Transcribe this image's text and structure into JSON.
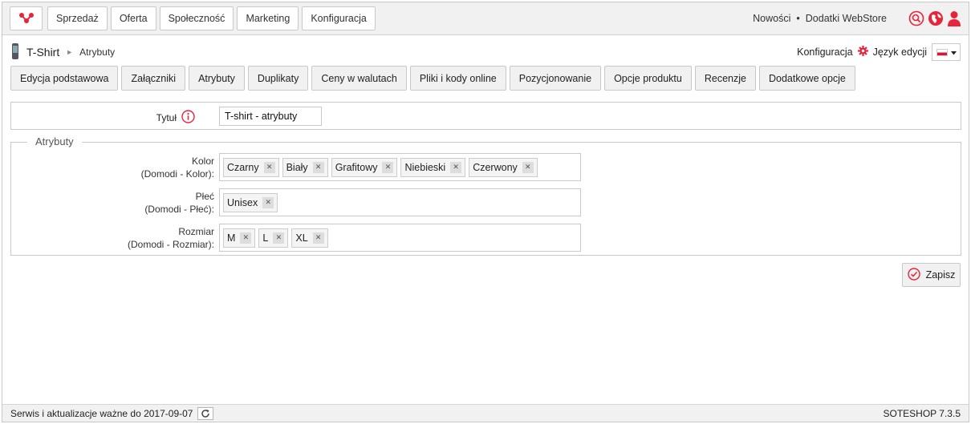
{
  "topbar": {
    "logo_icon": "soteshop-logo-icon",
    "nav": [
      {
        "label": "Sprzedaż"
      },
      {
        "label": "Oferta"
      },
      {
        "label": "Społeczność"
      },
      {
        "label": "Marketing"
      },
      {
        "label": "Konfiguracja"
      }
    ],
    "news_label": "Nowości",
    "separator": "•",
    "addons_label": "Dodatki WebStore",
    "icons": [
      "search-icon",
      "globe-icon",
      "user-icon"
    ],
    "accent_color": "#e8233a"
  },
  "breadcrumb": {
    "product": "T-Shirt",
    "arrow": "►",
    "current": "Atrybuty",
    "config_label": "Konfiguracja",
    "lang_label": "Język edycji"
  },
  "tabs": [
    {
      "label": "Edycja podstawowa"
    },
    {
      "label": "Załączniki"
    },
    {
      "label": "Atrybuty"
    },
    {
      "label": "Duplikaty"
    },
    {
      "label": "Ceny w walutach"
    },
    {
      "label": "Pliki i kody online"
    },
    {
      "label": "Pozycjonowanie"
    },
    {
      "label": "Opcje produktu"
    },
    {
      "label": "Recenzje"
    },
    {
      "label": "Dodatkowe opcje"
    }
  ],
  "title_field": {
    "label": "Tytuł",
    "value": "T-shirt - atrybuty"
  },
  "attributes": {
    "legend": "Atrybuty",
    "rows": [
      {
        "name": "Kolor",
        "sub": "(Domodi - Kolor):",
        "tags": [
          "Czarny",
          "Biały",
          "Grafitowy",
          "Niebieski",
          "Czerwony"
        ]
      },
      {
        "name": "Płeć",
        "sub": "(Domodi - Płeć):",
        "tags": [
          "Unisex"
        ]
      },
      {
        "name": "Rozmiar",
        "sub": "(Domodi - Rozmiar):",
        "tags": [
          "M",
          "L",
          "XL"
        ]
      }
    ]
  },
  "save_label": "Zapisz",
  "footer": {
    "service_text": "Serwis i aktualizacje ważne do 2017-09-07",
    "version": "SOTESHOP 7.3.5"
  }
}
